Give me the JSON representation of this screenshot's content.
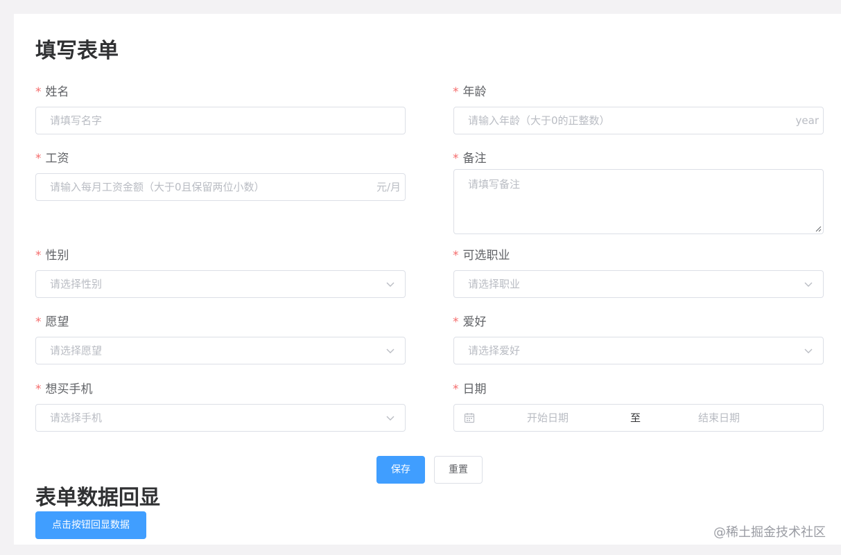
{
  "form": {
    "title": "填写表单",
    "required_mark": "*",
    "name": {
      "label": "姓名",
      "placeholder": "请填写名字"
    },
    "age": {
      "label": "年龄",
      "placeholder": "请输入年龄（大于0的正整数）",
      "suffix": "year"
    },
    "salary": {
      "label": "工资",
      "placeholder": "请输入每月工资金额（大于0且保留两位小数）",
      "suffix": "元/月"
    },
    "remark": {
      "label": "备注",
      "placeholder": "请填写备注"
    },
    "gender": {
      "label": "性别",
      "placeholder": "请选择性别"
    },
    "job": {
      "label": "可选职业",
      "placeholder": "请选择职业"
    },
    "wish": {
      "label": "愿望",
      "placeholder": "请选择愿望"
    },
    "hobby": {
      "label": "爱好",
      "placeholder": "请选择爱好"
    },
    "phone": {
      "label": "想买手机",
      "placeholder": "请选择手机"
    },
    "date": {
      "label": "日期",
      "start_placeholder": "开始日期",
      "separator": "至",
      "end_placeholder": "结束日期"
    },
    "save_label": "保存",
    "reset_label": "重置"
  },
  "echo": {
    "title": "表单数据回显",
    "button_label": "点击按钮回显数据"
  },
  "watermark": "@稀土掘金技术社区",
  "colors": {
    "primary": "#409eff",
    "required": "#f56c6c",
    "border": "#dcdfe6",
    "placeholder": "#b9bcc3"
  },
  "icons": {
    "select": "chevron-down-icon",
    "date": "calendar-icon",
    "resize": "resize-grip-icon"
  }
}
